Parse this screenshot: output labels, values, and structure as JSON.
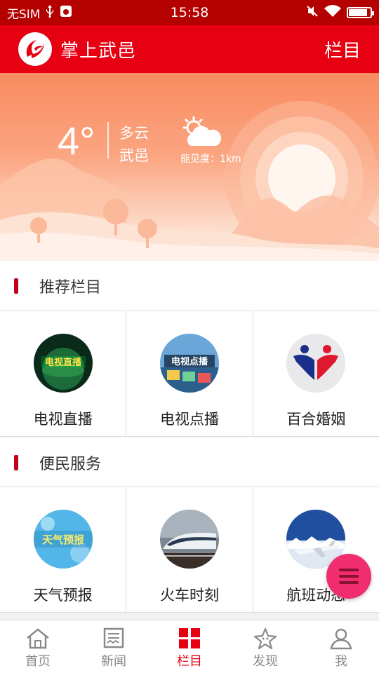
{
  "status_bar": {
    "carrier": "无SIM",
    "time": "15:58"
  },
  "app_bar": {
    "title": "掌上武邑",
    "right_label": "栏目",
    "accent_color": "#e60012"
  },
  "weather": {
    "temperature": "4°",
    "condition": "多云",
    "city": "武邑",
    "visibility": "能见度：1km",
    "icon": "partly-cloudy-icon"
  },
  "sections": [
    {
      "title": "推荐栏目",
      "items": [
        {
          "label": "电视直播",
          "icon": "tv-live-thumb"
        },
        {
          "label": "电视点播",
          "icon": "tv-vod-thumb"
        },
        {
          "label": "百合婚姻",
          "icon": "marriage-thumb"
        }
      ]
    },
    {
      "title": "便民服务",
      "items": [
        {
          "label": "天气预报",
          "icon": "weather-forecast-thumb"
        },
        {
          "label": "火车时刻",
          "icon": "train-schedule-thumb"
        },
        {
          "label": "航班动态",
          "icon": "flight-status-thumb"
        }
      ]
    }
  ],
  "bottom_nav": [
    {
      "label": "首页",
      "icon": "home-icon"
    },
    {
      "label": "新闻",
      "icon": "news-icon"
    },
    {
      "label": "栏目",
      "icon": "grid-icon",
      "active": true
    },
    {
      "label": "发现",
      "icon": "discover-icon"
    },
    {
      "label": "我",
      "icon": "profile-icon"
    }
  ]
}
